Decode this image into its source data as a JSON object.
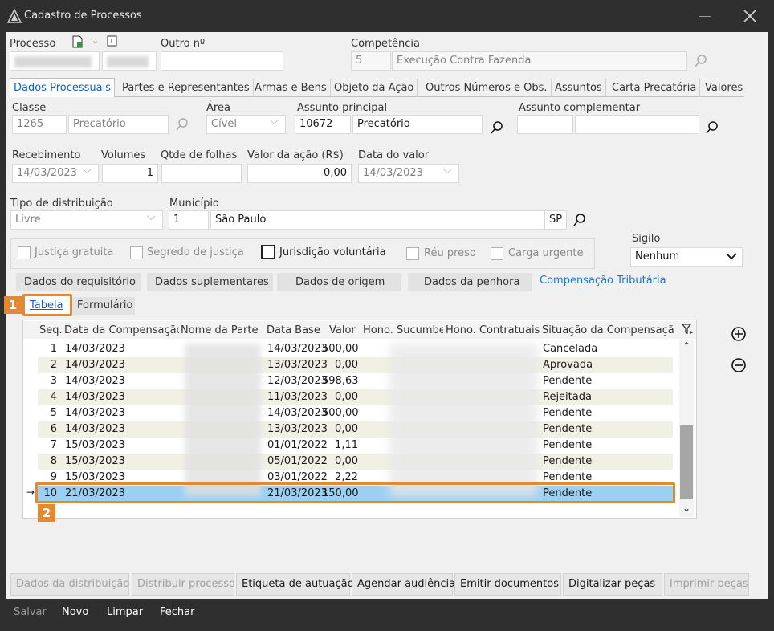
{
  "window": {
    "title": "Cadastro de Processos"
  },
  "header": {
    "processo_label": "Processo",
    "outro_label": "Outro nº",
    "competencia_label": "Competência",
    "competencia_code": "5",
    "competencia_value": "Execução Contra Fazenda"
  },
  "tabs": [
    "Dados Processuais",
    "Partes e Representantes",
    "Armas e Bens",
    "Objeto da Ação",
    "Outros Números e Obs.",
    "Assuntos",
    "Carta Precatória",
    "Valores"
  ],
  "form": {
    "classe_label": "Classe",
    "classe_code": "1265",
    "classe_value": "Precatório",
    "area_label": "Área",
    "area_value": "Cível",
    "assunto_principal_label": "Assunto principal",
    "assunto_principal_code": "10672",
    "assunto_principal_value": "Precatório",
    "assunto_complementar_label": "Assunto complementar",
    "recebimento_label": "Recebimento",
    "recebimento_value": "14/03/2023",
    "volumes_label": "Volumes",
    "volumes_value": "1",
    "folhas_label": "Qtde de folhas",
    "valor_label": "Valor da ação (R$)",
    "valor_value": "0,00",
    "data_valor_label": "Data do valor",
    "data_valor_value": "14/03/2023",
    "tipo_dist_label": "Tipo de distribuição",
    "tipo_dist_value": "Livre",
    "municipio_label": "Município",
    "municipio_code": "1",
    "municipio_value": "São Paulo",
    "municipio_uf": "SP",
    "sigilo_label": "Sigilo",
    "sigilo_value": "Nenhum"
  },
  "checks": [
    "Justiça gratuita",
    "Segredo de justiça",
    "Jurisdição voluntária",
    "Réu preso",
    "Carga urgente"
  ],
  "subtabs": [
    "Dados do requisitório",
    "Dados suplementares",
    "Dados de origem",
    "Dados da penhora",
    "Compensação Tributária"
  ],
  "view_tabs": [
    "Tabela",
    "Formulário"
  ],
  "grid": {
    "columns": [
      "Seq.",
      "Data da Compensação",
      "Nome da Parte",
      "Data Base",
      "Valor",
      "Hono. Sucumbe",
      "Hono. Contratuais",
      "Situação da Compensação"
    ],
    "rows": [
      {
        "seq": "1",
        "data": "14/03/2023",
        "base": "14/03/2023",
        "valor": "500,00",
        "sit": "Cancelada"
      },
      {
        "seq": "2",
        "data": "14/03/2023",
        "base": "13/03/2023",
        "valor": "0,00",
        "sit": "Aprovada"
      },
      {
        "seq": "3",
        "data": "14/03/2023",
        "base": "12/03/2023",
        "valor": "598,63",
        "sit": "Pendente"
      },
      {
        "seq": "4",
        "data": "14/03/2023",
        "base": "11/03/2023",
        "valor": "0,00",
        "sit": "Rejeitada"
      },
      {
        "seq": "5",
        "data": "14/03/2023",
        "base": "14/03/2023",
        "valor": "500,00",
        "sit": "Pendente"
      },
      {
        "seq": "6",
        "data": "14/03/2023",
        "base": "13/03/2023",
        "valor": "0,00",
        "sit": "Pendente"
      },
      {
        "seq": "7",
        "data": "15/03/2023",
        "base": "01/01/2022",
        "valor": "1,11",
        "sit": "Pendente"
      },
      {
        "seq": "8",
        "data": "15/03/2023",
        "base": "05/01/2022",
        "valor": "0,00",
        "sit": "Pendente"
      },
      {
        "seq": "9",
        "data": "15/03/2023",
        "base": "03/01/2022",
        "valor": "2,22",
        "sit": "Pendente"
      },
      {
        "seq": "10",
        "data": "21/03/2023",
        "base": "21/03/2023",
        "valor": "150,00",
        "sit": "Pendente"
      }
    ]
  },
  "badges": {
    "one": "1",
    "two": "2"
  },
  "bottom_buttons": [
    "Dados da distribuição",
    "Distribuir processo",
    "Etiqueta de autuação",
    "Agendar audiência",
    "Emitir documentos",
    "Digitalizar peças",
    "Imprimir peças"
  ],
  "status": [
    "Salvar",
    "Novo",
    "Limpar",
    "Fechar"
  ],
  "icons": {
    "add": "plus-circle-icon",
    "remove": "minus-circle-icon",
    "filter": "filter-icon",
    "search": "search-icon"
  }
}
